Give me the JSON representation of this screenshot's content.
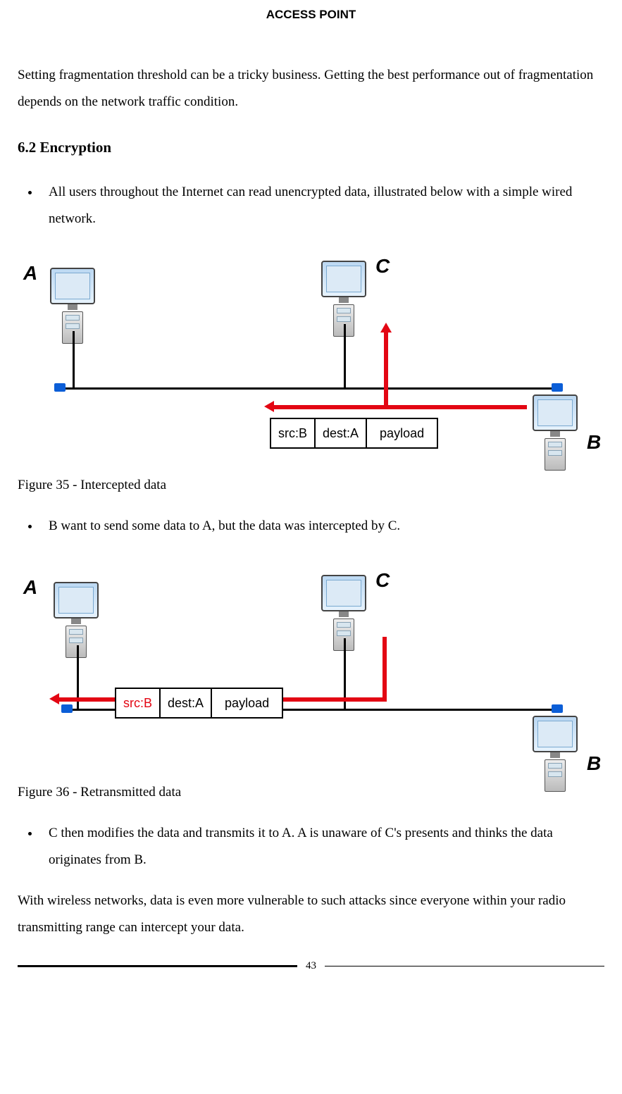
{
  "header": "ACCESS POINT",
  "para1": "Setting fragmentation threshold can be a tricky business. Getting the best performance out of fragmentation depends on the network traffic condition.",
  "section_6_2": "6.2 Encryption",
  "bullet1": "All users throughout the Internet can read unencrypted data, illustrated below with a simple wired network.",
  "fig35_caption": "Figure 35 - Intercepted data",
  "bullet2": "B want to send some data to A, but the data was intercepted by C.",
  "fig36_caption": "Figure 36 - Retransmitted data",
  "bullet3": "C then modifies the data and transmits it to A. A is unaware of C's presents and thinks the data originates from B.",
  "para2": "With wireless networks, data is even more vulnerable to such attacks since everyone within your radio transmitting range can intercept your data.",
  "page_number": "43",
  "fig35": {
    "labels": {
      "A": "A",
      "B": "B",
      "C": "C"
    },
    "packet": {
      "src": "src:B",
      "dest": "dest:A",
      "payload": "payload"
    }
  },
  "fig36": {
    "labels": {
      "A": "A",
      "B": "B",
      "C": "C"
    },
    "packet": {
      "src": "src:B",
      "dest": "dest:A",
      "payload": "payload"
    }
  }
}
